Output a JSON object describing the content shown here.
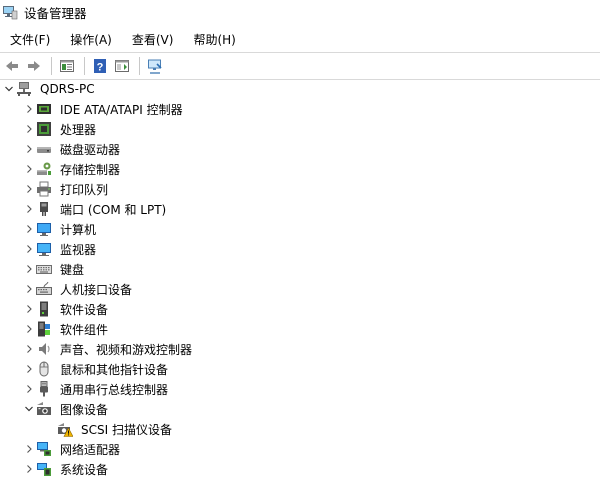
{
  "window": {
    "title": "设备管理器"
  },
  "menu": [
    {
      "label": "文件(F)"
    },
    {
      "label": "操作(A)"
    },
    {
      "label": "查看(V)"
    },
    {
      "label": "帮助(H)"
    }
  ],
  "toolbar": [
    {
      "icon": "back-arrow-icon"
    },
    {
      "icon": "forward-arrow-icon"
    },
    {
      "icon": "properties-icon"
    },
    {
      "icon": "help-icon"
    },
    {
      "icon": "show-hide-console-icon"
    },
    {
      "icon": "scan-hardware-icon"
    }
  ],
  "tree": {
    "root": {
      "label": "QDRS-PC",
      "expanded": true
    },
    "categories": [
      {
        "label": "IDE ATA/ATAPI 控制器",
        "icon": "ide-controller-icon"
      },
      {
        "label": "处理器",
        "icon": "processor-icon"
      },
      {
        "label": "磁盘驱动器",
        "icon": "disk-drive-icon"
      },
      {
        "label": "存储控制器",
        "icon": "storage-controller-icon"
      },
      {
        "label": "打印队列",
        "icon": "printer-icon"
      },
      {
        "label": "端口 (COM 和 LPT)",
        "icon": "port-icon"
      },
      {
        "label": "计算机",
        "icon": "computer-icon"
      },
      {
        "label": "监视器",
        "icon": "monitor-icon"
      },
      {
        "label": "键盘",
        "icon": "keyboard-icon"
      },
      {
        "label": "人机接口设备",
        "icon": "hid-icon"
      },
      {
        "label": "软件设备",
        "icon": "software-device-icon"
      },
      {
        "label": "软件组件",
        "icon": "software-component-icon"
      },
      {
        "label": "声音、视频和游戏控制器",
        "icon": "speaker-icon"
      },
      {
        "label": "鼠标和其他指针设备",
        "icon": "mouse-icon"
      },
      {
        "label": "通用串行总线控制器",
        "icon": "usb-icon"
      },
      {
        "label": "图像设备",
        "icon": "camera-icon",
        "expanded": true,
        "children": [
          {
            "label": "SCSI 扫描仪设备",
            "icon": "scanner-warning-icon",
            "warning": true
          }
        ]
      },
      {
        "label": "网络适配器",
        "icon": "network-adapter-icon"
      },
      {
        "label": "系统设备",
        "icon": "system-device-icon"
      }
    ]
  },
  "colors": {
    "accent": "#0078d7",
    "warning": "#f0b400",
    "separator": "#d9d9d9"
  }
}
